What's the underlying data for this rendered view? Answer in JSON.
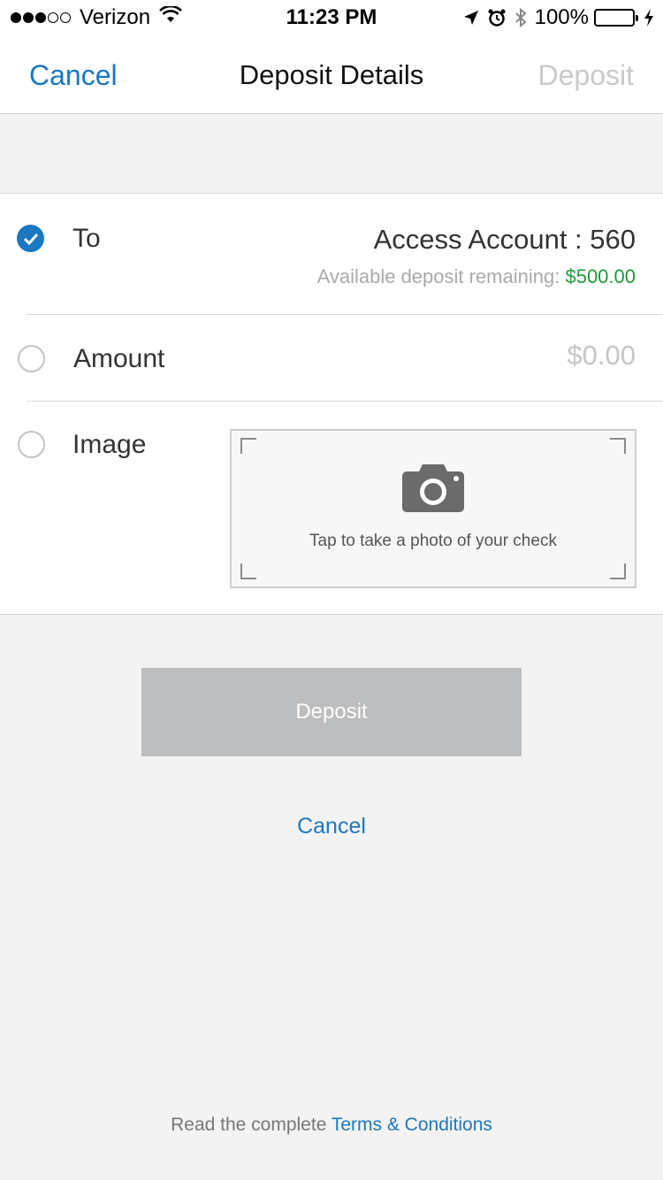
{
  "status_bar": {
    "carrier": "Verizon",
    "time": "11:23 PM",
    "battery": "100%",
    "icons": [
      "signal-dots-icon",
      "wifi-icon",
      "location-arrow-icon",
      "alarm-icon",
      "bluetooth-icon",
      "battery-icon",
      "charging-bolt-icon"
    ]
  },
  "nav": {
    "cancel": "Cancel",
    "title": "Deposit Details",
    "deposit": "Deposit"
  },
  "form": {
    "to_label": "To",
    "account_name": "Access Account : 560",
    "remaining_label": "Available deposit remaining: ",
    "remaining_value": "$500.00",
    "amount_label": "Amount",
    "amount_value": "$0.00",
    "image_label": "Image",
    "photo_prompt": "Tap to take a photo of your check"
  },
  "actions": {
    "deposit_button": "Deposit",
    "cancel_link": "Cancel"
  },
  "footer": {
    "terms_prefix": "Read the complete ",
    "terms_link": "Terms & Conditions"
  },
  "colors": {
    "accent": "#1a78c2",
    "positive": "#1f9a3a",
    "disabled_button": "#bcbdbf",
    "background": "#f3f3f3"
  }
}
